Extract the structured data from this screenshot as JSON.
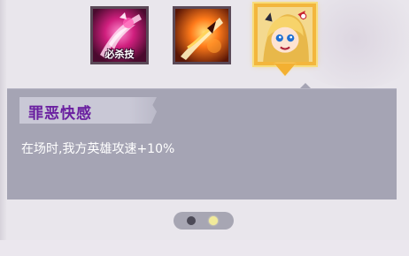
{
  "skills": [
    {
      "name": "ultimate-skill",
      "tag": "必杀技",
      "selected": false,
      "palette": "magenta"
    },
    {
      "name": "fire-slash-skill",
      "selected": false,
      "palette": "orange"
    },
    {
      "name": "hero-portrait-skill",
      "selected": true,
      "palette": "gold"
    }
  ],
  "detail": {
    "title": "罪恶快感",
    "description": "在场时,我方英雄攻速+10%"
  },
  "pager": {
    "total": 2,
    "active": 2
  },
  "colors": {
    "panel": "#a5a4b4",
    "title_text": "#6a1fa0",
    "selection_border": "#f3b63d",
    "dot_active": "#f1ea9a",
    "dot_inactive": "#4c4a57"
  }
}
